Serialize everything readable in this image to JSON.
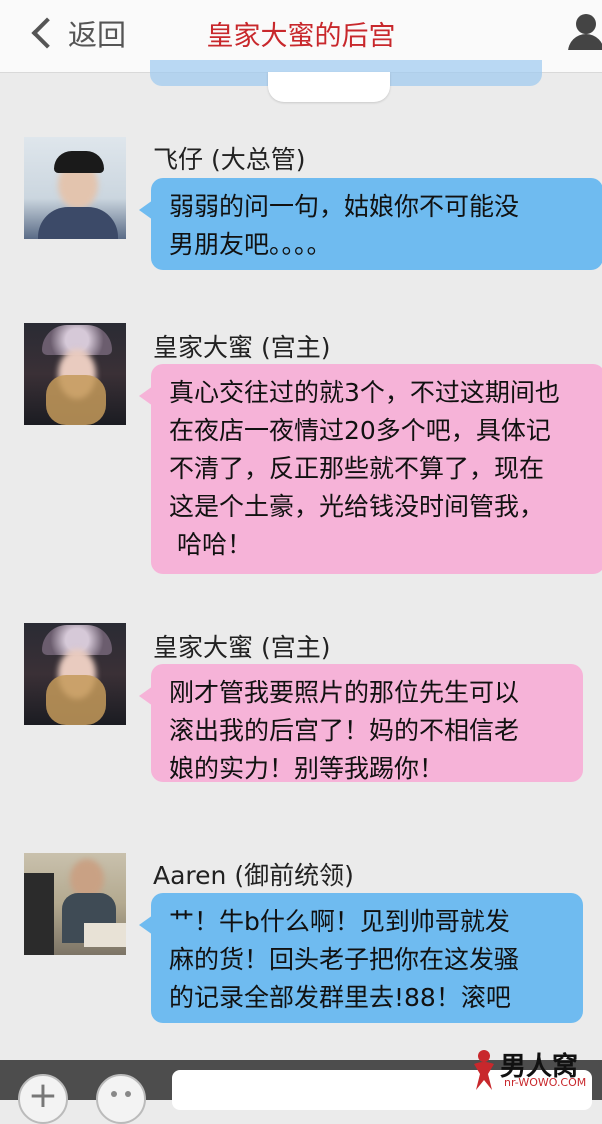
{
  "header": {
    "back_label": "返回",
    "title": "皇家大蜜的后宫"
  },
  "messages": [
    {
      "sender": "飞仔 (大总管)",
      "bubble_color": "#6fbbf0",
      "lines": [
        "弱弱的问一句，姑娘你不可能没",
        "男朋友吧。。。。"
      ]
    },
    {
      "sender": "皇家大蜜 (宫主)",
      "bubble_color": "#f6b3d8",
      "lines": [
        "真心交往过的就3个，不过这期间也",
        "在夜店一夜情过20多个吧，具体记",
        "不清了，反正那些就不算了，现在",
        "这是个土豪，光给钱没时间管我，",
        " 哈哈！"
      ]
    },
    {
      "sender": "皇家大蜜 (宫主)",
      "bubble_color": "#f6b3d8",
      "lines": [
        "刚才管我要照片的那位先生可以",
        "滚出我的后宫了！妈的不相信老",
        "娘的实力！别等我踢你！"
      ]
    },
    {
      "sender": "Aaren (御前统领)",
      "bubble_color": "#6fbbf0",
      "lines": [
        "艹！牛b什么啊！见到帅哥就发",
        "麻的货！回头老子把你在这发骚",
        "的记录全部发群里去!88！滚吧"
      ]
    }
  ],
  "bottom_bar": {
    "plus_icon": "+",
    "emoji_icon": "emoji-icon"
  },
  "watermark": {
    "text": "男人窝",
    "url": "nr-WOWO.COM"
  },
  "colors": {
    "accent_title": "#c8282c",
    "blue_bubble": "#6fbbf0",
    "pink_bubble": "#f6b3d8"
  }
}
